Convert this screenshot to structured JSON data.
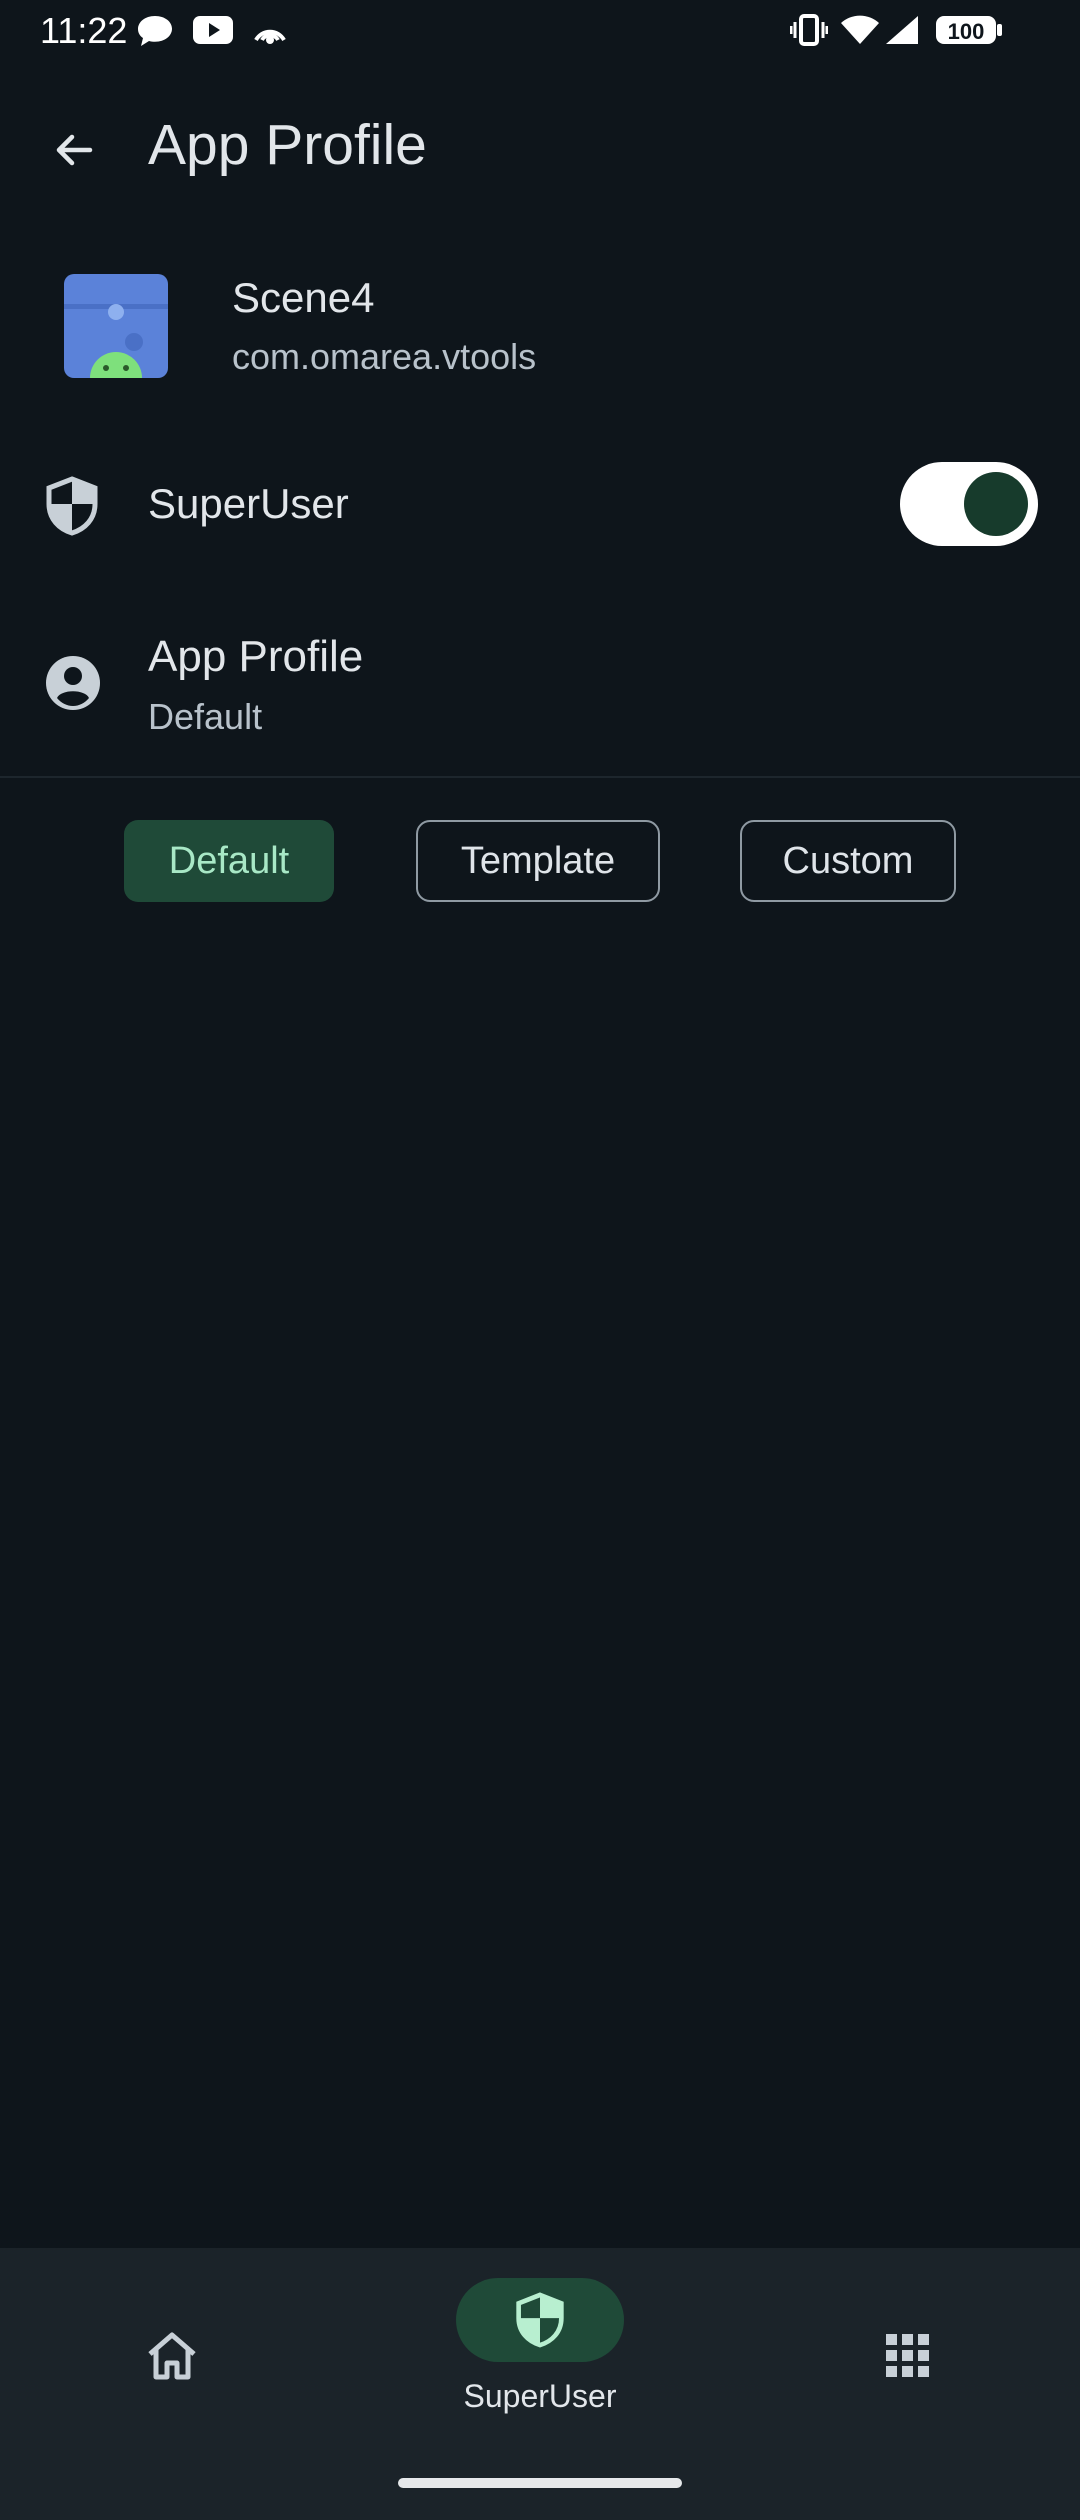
{
  "status_bar": {
    "time": "11:22",
    "battery": "100",
    "icons": [
      "chat-bubble-icon",
      "youtube-icon",
      "hotspot-icon",
      "vibrate-icon",
      "wifi-icon",
      "signal-icon",
      "battery-icon"
    ]
  },
  "header": {
    "title": "App Profile",
    "back_icon": "arrow-back-icon"
  },
  "app": {
    "name": "Scene4",
    "package": "com.omarea.vtools"
  },
  "superuser": {
    "label": "SuperUser",
    "enabled": true
  },
  "app_profile": {
    "title": "App Profile",
    "value": "Default"
  },
  "profile_options": {
    "selected": "Default",
    "items": [
      "Default",
      "Template",
      "Custom"
    ]
  },
  "bottom_nav": {
    "items": [
      {
        "icon": "home-icon",
        "label": ""
      },
      {
        "icon": "shield-icon",
        "label": "SuperUser",
        "active": true
      },
      {
        "icon": "apps-grid-icon",
        "label": ""
      }
    ]
  },
  "colors": {
    "background": "#0e151b",
    "accent_container": "#1f4a38",
    "accent_text": "#a8e8c6",
    "nav_background": "#1b2329"
  }
}
